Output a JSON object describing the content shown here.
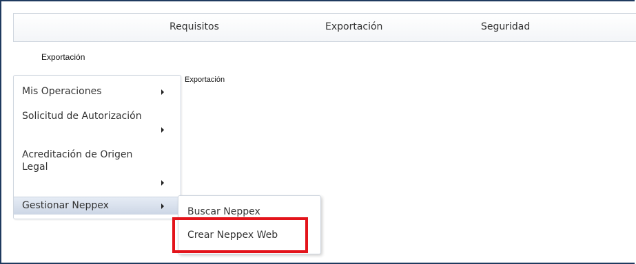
{
  "nav": {
    "items": [
      "Requisitos",
      "Exportación",
      "Seguridad"
    ]
  },
  "breadcrumb": "Exportación",
  "content": {
    "title": "Exportación"
  },
  "side_menu": {
    "items": [
      {
        "label": "Mis Operaciones"
      },
      {
        "label": "Solicitud de Autorización"
      },
      {
        "label": "Acreditación de Origen Legal"
      },
      {
        "label": "Gestionar Neppex"
      }
    ]
  },
  "submenu": {
    "items": [
      {
        "label": "Buscar Neppex"
      },
      {
        "label": "Crear Neppex Web"
      }
    ]
  },
  "highlight_color": "#e3141b",
  "icons": [
    "submenu-arrow-icon"
  ]
}
